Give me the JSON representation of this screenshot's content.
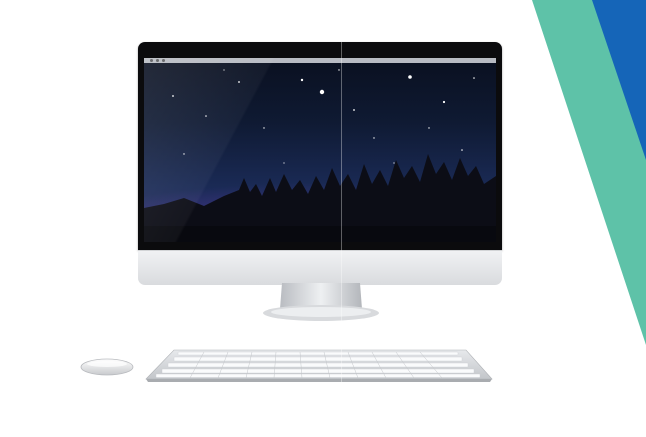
{
  "scene": {
    "description_icons": [
      "desktop-computer-icon",
      "wireless-mouse-icon",
      "keyboard-icon"
    ],
    "colors": {
      "background": "#ffffff",
      "teal_stripe": "#5ec2a8",
      "blue_stripe": "#1565b8",
      "screen_top": "#0a1020",
      "screen_bottom": "#2b2d6a"
    }
  }
}
